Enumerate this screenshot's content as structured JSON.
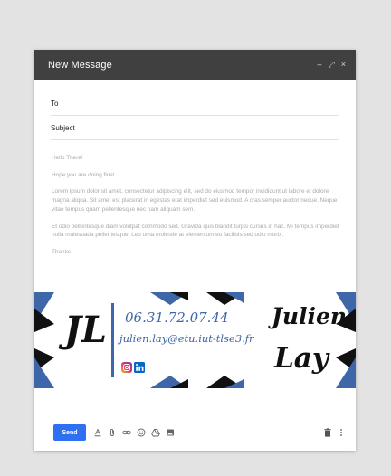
{
  "window": {
    "title": "New Message",
    "controls": {
      "minimize": "–",
      "expand": "⤢",
      "close": "×"
    }
  },
  "fields": {
    "to_label": "To",
    "subject_label": "Subject"
  },
  "message": {
    "paragraphs": [
      "Hello There!",
      "Hope you are doing fine!",
      "Lorem ipsum dolor sit amet, consectetur adipiscing elit, sed do eiusmod tempor incididunt ut labore et dolore magna aliqua. Sit amet est placerat in egestas erat imperdiet sed euismod. A cras semper auctor neque. Neque vitae tempus quam pellentesque nec nam aliquam sem.",
      "Et odio pellentesque diam volutpat commodo sed. Gravida quis blandit turpis cursus in hac. Mi tempus imperdiet nulla malesuada pellentesque. Leo urna molestie at elementum eu facilisis sed odio morbi.",
      "Thanks"
    ]
  },
  "signature": {
    "initials": "JL",
    "phone": "06.31.72.07.44",
    "email": "julien.lay@etu.iut-tlse3.fr",
    "first_name": "Julien",
    "last_name": "Lay",
    "social": [
      "instagram",
      "linkedin"
    ],
    "colors": {
      "accent": "#3d67a8",
      "dark": "#111111"
    }
  },
  "toolbar": {
    "send_label": "Send",
    "icons": [
      "format-text-icon",
      "attach-icon",
      "link-icon",
      "emoji-icon",
      "drive-icon",
      "photo-icon"
    ],
    "right_icons": [
      "trash-icon",
      "more-options-icon"
    ]
  },
  "colors": {
    "titlebar": "#404040",
    "send": "#2f6ff2",
    "body_text": "#a9a9a9"
  }
}
